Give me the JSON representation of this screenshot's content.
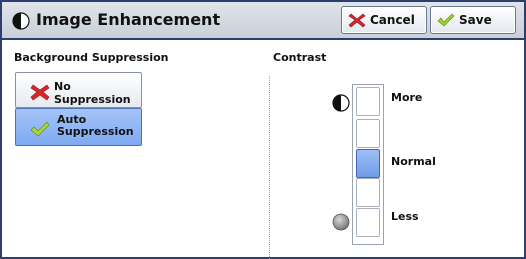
{
  "window": {
    "title": "Image Enhancement"
  },
  "toolbar": {
    "cancel_label": "Cancel",
    "save_label": "Save"
  },
  "background_suppression": {
    "label": "Background Suppression",
    "options": [
      {
        "label": "No Suppression",
        "selected": false,
        "icon": "red-x-icon"
      },
      {
        "label_line1": "Auto",
        "label_line2": "Suppression",
        "selected": true,
        "icon": "green-check-icon"
      }
    ]
  },
  "contrast": {
    "label": "Contrast",
    "levels": [
      "More",
      "",
      "Normal",
      "",
      "Less"
    ],
    "selected_index": 2,
    "more_label": "More",
    "normal_label": "Normal",
    "less_label": "Less"
  },
  "colors": {
    "title_border": "#2d3f6e",
    "selected": "#7ea9f1"
  }
}
